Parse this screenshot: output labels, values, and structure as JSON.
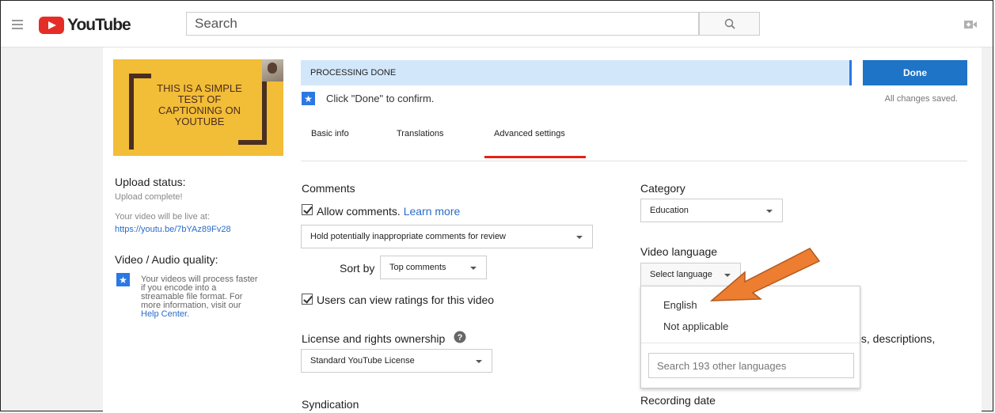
{
  "header": {
    "logo_text": "YouTube",
    "search_placeholder": "Search"
  },
  "thumbnail": {
    "caption": "THIS IS A SIMPLE TEST OF CAPTIONING ON YOUTUBE"
  },
  "left_panel": {
    "upload_status_title": "Upload status:",
    "upload_status_value": "Upload complete!",
    "live_text": "Your video will be live at:",
    "live_url": "https://youtu.be/7bYAz89Fv28",
    "quality_title": "Video / Audio quality:",
    "quality_note": "Your videos will process faster if you encode into a streamable file format. For more information, visit our",
    "help_center": "Help Center."
  },
  "status": {
    "processing": "PROCESSING DONE",
    "done_label": "Done",
    "saved_text": "All changes saved.",
    "confirm_text": "Click \"Done\" to confirm."
  },
  "tabs": [
    {
      "label": "Basic info"
    },
    {
      "label": "Translations"
    },
    {
      "label": "Advanced settings"
    }
  ],
  "settings": {
    "comments_title": "Comments",
    "allow_comments": "Allow comments.",
    "learn_more": "Learn more",
    "hold_option": "Hold potentially inappropriate comments for review",
    "sort_by_label": "Sort by",
    "sort_value": "Top comments",
    "ratings_label": "Users can view ratings for this video",
    "license_title": "License and rights ownership",
    "license_value": "Standard YouTube License",
    "syndication_title": "Syndication",
    "category_title": "Category",
    "category_value": "Education",
    "video_language_title": "Video language",
    "select_language": "Select language",
    "partial_text": "les, descriptions,",
    "recording_date_title": "Recording date"
  },
  "language_popup": {
    "options": [
      "English",
      "Not applicable"
    ],
    "search_placeholder": "Search 193 other languages"
  },
  "colors": {
    "brand_red": "#e52d27",
    "accent_blue": "#1e74c6",
    "banner_blue": "#d3e7fb",
    "annotation_orange": "#ed7d31"
  }
}
